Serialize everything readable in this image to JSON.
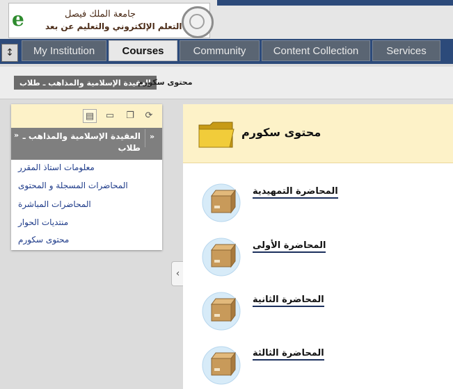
{
  "header": {
    "logo_line1": "جامعة الملك فيصل",
    "logo_line2": "عمادة التعلم الإلكتروني والتعليم عن بعد"
  },
  "tabs": [
    {
      "label": "My Institution"
    },
    {
      "label": "Courses"
    },
    {
      "label": "Community"
    },
    {
      "label": "Content Collection"
    },
    {
      "label": "Services"
    }
  ],
  "breadcrumb": {
    "course": "العقيدة الإسلامية والمذاهب ـ طلاب",
    "current": "محتوى سكورم"
  },
  "course_menu": {
    "title": "العقيدة الإسلامية والمذاهب ـ طلاب",
    "items": [
      {
        "label": "معلومات استاذ المقرر"
      },
      {
        "label": "المحاضرات المسجلة و المحتوى"
      },
      {
        "label": "المحاضرات المباشرة"
      },
      {
        "label": "منتديات الحوار"
      },
      {
        "label": "محتوى سكورم"
      }
    ]
  },
  "content": {
    "title": "محتوى سكورم",
    "items": [
      {
        "title": "المحاضرة التمهيدية"
      },
      {
        "title": "المحاضرة الأولى"
      },
      {
        "title": "المحاضرة الثانية"
      },
      {
        "title": "المحاضرة الثالثة"
      }
    ]
  },
  "colors": {
    "nav_bg": "#2c4a7a",
    "tab_bg": "#5a6573",
    "panel_head": "#fdf2c8",
    "menu_link": "#1f3c8a"
  }
}
